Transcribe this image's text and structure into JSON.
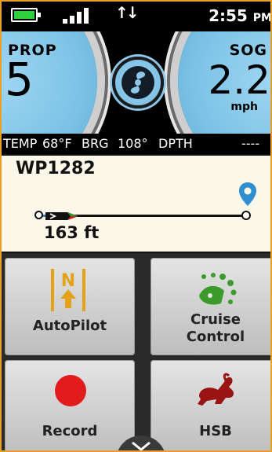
{
  "status_bar": {
    "time": "2:55",
    "ampm": "PM"
  },
  "gauges": {
    "prop": {
      "label": "PROP",
      "value": "5"
    },
    "sog": {
      "label": "SOG",
      "value": "2.2",
      "unit": "mph"
    }
  },
  "info_strip": {
    "temp_label": "TEMP",
    "temp_value": "68°F",
    "brg_label": "BRG",
    "brg_value": "108°",
    "dpth_label": "DPTH",
    "dpth_value": "----"
  },
  "waypoint": {
    "name": "WP1282",
    "distance": "163 ft"
  },
  "tiles": {
    "autopilot": {
      "label": "AutoPilot"
    },
    "cruise": {
      "label_line1": "Cruise",
      "label_line2": "Control"
    },
    "record": {
      "label": "Record"
    },
    "hsb": {
      "label": "HSB"
    }
  },
  "colors": {
    "accent": "#e8a02a",
    "battery": "#2ed03c",
    "gauge_blue": "#7cc2e6",
    "cruise_green": "#3a9a2a",
    "record_red": "#e21c1c",
    "hsb_red": "#9a1414",
    "waypoint_pin": "#2f8fd0"
  },
  "icons": {
    "battery": "battery-icon",
    "signal": "signal-icon",
    "data_arrows": "data-transfer-icon",
    "center": "propeller-icon",
    "autopilot": "autopilot-north-icon",
    "cruise": "cruise-control-icon",
    "record": "record-icon",
    "hsb": "rabbit-icon",
    "waypoint": "location-pin-icon",
    "expand": "chevron-down-icon"
  }
}
